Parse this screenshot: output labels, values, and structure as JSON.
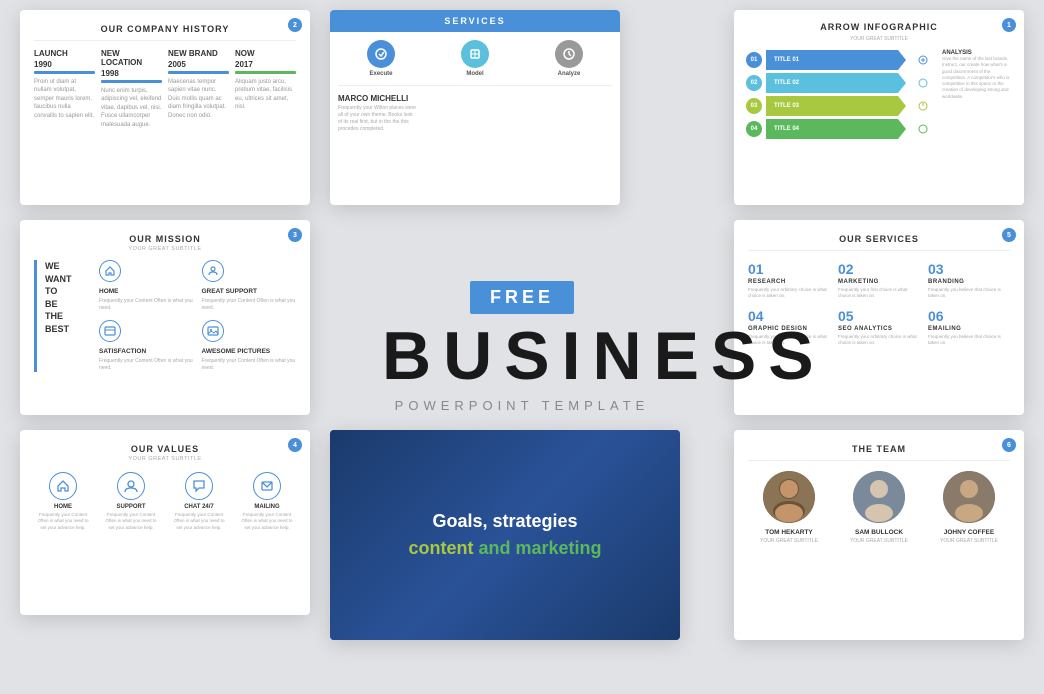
{
  "center": {
    "free_badge": "FREE",
    "title": "BUSINESS",
    "subtitle": "POWERPOINT TEMPLATE"
  },
  "slide_history": {
    "title": "OUR COMPANY HISTORY",
    "badge": "2",
    "col1_year": "LAUNCH",
    "col1_year2": "1990",
    "col2_label": "NEW LOCATION",
    "col2_year": "1998",
    "col3_label": "NEW BRAND",
    "col3_year": "2005",
    "col4_label": "NOW",
    "col4_year": "2017",
    "text1": "Proin ut diam at nullam volutpat, semper mauris lorem, faucibus nulla convallis to sapien elit.",
    "text2": "Nunc enim turpis, adipiscing vel, eleifend vitae, dapibus vel, nisi. Fusce ullamcorper malesuada augue.",
    "text3": "Maecenas tempor sapien vitae nunc. Duis mollis quam ac diam fringilla volutpat. Donec non odio.",
    "text4": "Aliquam justo arcu, pretium vitae, facilisis eu, ultrices sit amet, nisl."
  },
  "slide_services_top": {
    "title": "SERVICES",
    "icon1": "Execute",
    "icon2": "Model",
    "icon3": "Analyze",
    "person_name": "MARCO MICHELLI",
    "description": "Frequently your Wilton places were all of your own theme. Books look of its real first, but in the the this procedes completed."
  },
  "slide_arrow": {
    "title": "ARROW INFOGRAPHIC",
    "subtitle": "YOUR GREAT SUBTITLE",
    "badge": "1",
    "row1_num": "01",
    "row1_label": "TITLE 01",
    "row2_num": "02",
    "row2_label": "TITLE 02",
    "row3_num": "03",
    "row3_label": "TITLE 03",
    "row4_num": "04",
    "row4_label": "TITLE 04",
    "analysis_title": "ANALYSIS",
    "analysis_text": "Give the name of the last brands. Instruct, our create how what's a good discernment of the competition. A competitor's who is competitive in this space or the creation of developing strong and worldwide."
  },
  "slide_mission": {
    "title": "OUR MISSION",
    "subtitle": "YOUR GREAT SUBTITLE",
    "badge": "3",
    "big_line1": "WE",
    "big_line2": "WANT",
    "big_line3": "TO",
    "big_line4": "BE",
    "big_line5": "THE BEST",
    "item1_title": "HOME",
    "item1_text": "Frequently your Content Often is what you need.",
    "item2_title": "GREAT SUPPORT",
    "item2_text": "Frequently your Content Often is what you need.",
    "item3_title": "SATISFACTION",
    "item3_text": "Frequently your Content Often is what you need.",
    "item4_title": "AWESOME PICTURES",
    "item4_text": "Frequently your Content Often is what you need."
  },
  "slide_values": {
    "title": "OUR VALUES",
    "subtitle": "YOUR GREAT SUBTITLE",
    "badge": "4",
    "item1_label": "HOME",
    "item1_text": "Frequently your Content Often is what you need to set your advance help.",
    "item2_label": "SUPPORT",
    "item2_text": "Frequently your Content Often is what you need to set your advance help.",
    "item3_label": "CHAT 24/7",
    "item3_text": "Frequently your Content Often is what you need to set your advance help.",
    "item4_label": "MAILING",
    "item4_text": "Frequently your Content Often is what you need to set your advance help."
  },
  "slide_goals": {
    "line1": "Goals, strategies",
    "line2_part1": "content",
    "line2_part2": " and marketing"
  },
  "slide_our_services": {
    "title": "OUR SERVICES",
    "badge": "5",
    "s1_num": "01",
    "s1_label": "RESEARCH",
    "s1_text": "Frequently your Arbitrary choice is what choice is taken on.",
    "s2_num": "02",
    "s2_label": "MARKETING",
    "s2_text": "Frequently your first choice is what choice is taken on.",
    "s3_num": "03",
    "s3_label": "BRANDING",
    "s3_text": "Frequently you believe that choice is taken on.",
    "s4_num": "04",
    "s4_label": "GRAPHIC DESIGN",
    "s4_text": "Frequently your Arbitrary choice is what choice is taken on.",
    "s5_num": "05",
    "s5_label": "SEO ANALYTICS",
    "s5_text": "Frequently your Arbitrary choice is what choice is taken on.",
    "s6_num": "06",
    "s6_label": "EMAILING",
    "s6_text": "Frequently you believe that choice is taken on."
  },
  "slide_team": {
    "title": "THE TEAM",
    "badge": "6",
    "m1_name": "TOM HEKARTY",
    "m1_role": "YOUR GREAT SUBTITLE",
    "m2_name": "SAM BULLOCK",
    "m2_role": "YOUR GREAT SUBTITLE",
    "m3_name": "JOHNY COFFEE",
    "m3_role": "YOUR GREAT SUBTITLE"
  },
  "colors": {
    "blue": "#4a90d9",
    "green": "#5cb85c",
    "teal": "#5bc0de",
    "gray": "#999",
    "dark_navy": "#1a3a6b",
    "lime": "#a8c840"
  }
}
